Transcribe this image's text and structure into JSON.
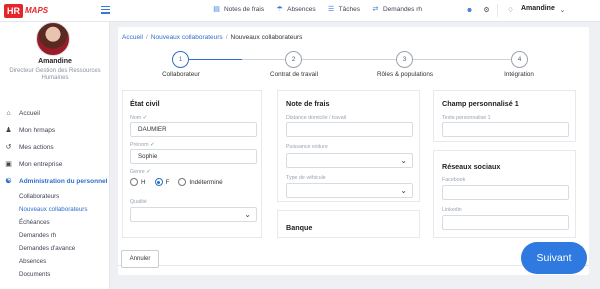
{
  "brand": {
    "hr": "HR",
    "maps": "MAPS"
  },
  "topnav": [
    {
      "label": "Notes de frais",
      "icon": "receipt-icon"
    },
    {
      "label": "Absences",
      "icon": "beach-umbrella-icon"
    },
    {
      "label": "Tâches",
      "icon": "tasks-icon"
    },
    {
      "label": "Demandes rh",
      "icon": "swap-arrows-icon"
    }
  ],
  "user": {
    "name": "Amandine"
  },
  "profile": {
    "name": "Amandine",
    "role": "Directeur Gestion des Ressources Humaines"
  },
  "menu": [
    {
      "label": "Accueil",
      "icon": "home-icon"
    },
    {
      "label": "Mon hrmaps",
      "icon": "person-icon"
    },
    {
      "label": "Mes actions",
      "icon": "actions-icon"
    },
    {
      "label": "Mon entreprise",
      "icon": "briefcase-icon"
    },
    {
      "label": "Administration du personnel",
      "icon": "team-icon"
    }
  ],
  "submenu": [
    "Collaborateurs",
    "Nouveaux collaborateurs",
    "Échéances",
    "Demandes rh",
    "Demandes d'avance",
    "Absences",
    "Documents"
  ],
  "breadcrumb": {
    "home": "Accueil",
    "level1": "Nouveaux collaborateurs",
    "current": "Nouveaux collaborateurs"
  },
  "steps": [
    {
      "num": "1",
      "label": "Collaborateur"
    },
    {
      "num": "2",
      "label": "Contrat de travail"
    },
    {
      "num": "3",
      "label": "Rôles & populations"
    },
    {
      "num": "4",
      "label": "Intégration"
    }
  ],
  "etat_civil": {
    "title": "État civil",
    "nom_label": "Nom",
    "nom_value": "DAUMIER",
    "prenom_label": "Prénom",
    "prenom_value": "Sophie",
    "genre_label": "Genre",
    "genre_options": [
      "H",
      "F",
      "Indéterminé"
    ],
    "genre_selected": "F",
    "qualite_label": "Qualité"
  },
  "note_de_frais": {
    "title": "Note de frais",
    "distance_label": "Distance domicile / travail",
    "puissance_label": "Puissance voiture",
    "type_label": "Type de véhicule"
  },
  "banque": {
    "title": "Banque"
  },
  "champ_perso": {
    "title": "Champ personnalisé 1",
    "texte_label": "Texte personnalisé 1"
  },
  "reseaux": {
    "title": "Réseaux sociaux",
    "facebook_label": "Facebook",
    "linkedin_label": "Linkedin"
  },
  "buttons": {
    "annuler": "Annuler",
    "suivant": "Suivant"
  },
  "colors": {
    "accent": "#2f6fc9",
    "brand_red": "#e4262c",
    "primary_button": "#2f7ae0"
  }
}
